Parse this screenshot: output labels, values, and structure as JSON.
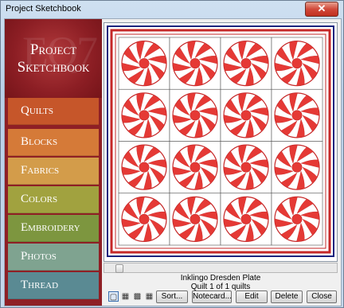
{
  "window": {
    "title": "Project Sketchbook",
    "close_glyph": "✕"
  },
  "brand": {
    "line1": "Project",
    "line2": "Sketchbook",
    "watermark": "EQ7"
  },
  "nav": {
    "items": [
      {
        "label": "Quilts",
        "color": "#c6562a"
      },
      {
        "label": "Blocks",
        "color": "#d57a38"
      },
      {
        "label": "Fabrics",
        "color": "#d39c4a"
      },
      {
        "label": "Colors",
        "color": "#a1a23f"
      },
      {
        "label": "Embroidery",
        "color": "#7d963f"
      },
      {
        "label": "Photos",
        "color": "#7fa390"
      },
      {
        "label": "Thread",
        "color": "#5a8a93"
      }
    ]
  },
  "quilt": {
    "name": "Inklingo Dresden Plate",
    "count_text": "Quilt 1 of 1 quilts",
    "rows": 4,
    "cols": 4,
    "colors": {
      "red": "#e53935",
      "dark_red": "#c62828",
      "navy": "#1a237e",
      "background": "#ffffff"
    }
  },
  "view_buttons": [
    {
      "name": "view-single-icon",
      "glyph": "▢",
      "active": true
    },
    {
      "name": "view-grid4-icon",
      "glyph": "▦",
      "active": false
    },
    {
      "name": "view-grid9-icon",
      "glyph": "▩",
      "active": false
    },
    {
      "name": "view-grid16-icon",
      "glyph": "▦",
      "active": false
    }
  ],
  "buttons": {
    "sort": "Sort...",
    "notecard": "Notecard...",
    "edit": "Edit",
    "delete": "Delete",
    "close": "Close"
  }
}
